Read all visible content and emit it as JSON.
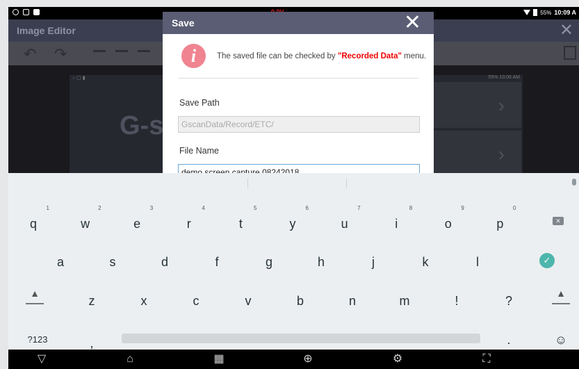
{
  "status_bar": {
    "battery_percent": "55%",
    "time": "10:09 A",
    "voltage": "0.0V"
  },
  "editor": {
    "title": "Image Editor",
    "preview_time": "55% 10:06 AM",
    "logo_text": "G-s"
  },
  "dialog": {
    "title": "Save",
    "message_prefix": "The saved file can be checked by ",
    "message_highlight": "\"Recorded Data\"",
    "message_suffix": " menu.",
    "save_path_label": "Save Path",
    "save_path_value": "GscanData/Record/ETC/",
    "file_name_label": "File Name",
    "file_name_value": "demo screen capture 08242018"
  },
  "keyboard": {
    "row1": [
      {
        "key": "q",
        "hint": "1"
      },
      {
        "key": "w",
        "hint": "2"
      },
      {
        "key": "e",
        "hint": "3"
      },
      {
        "key": "r",
        "hint": "4"
      },
      {
        "key": "t",
        "hint": "5"
      },
      {
        "key": "y",
        "hint": "6"
      },
      {
        "key": "u",
        "hint": "7"
      },
      {
        "key": "i",
        "hint": "8"
      },
      {
        "key": "o",
        "hint": "9"
      },
      {
        "key": "p",
        "hint": "0"
      }
    ],
    "row2": [
      "a",
      "s",
      "d",
      "f",
      "g",
      "h",
      "j",
      "k",
      "l"
    ],
    "row3": [
      "z",
      "x",
      "c",
      "v",
      "b",
      "n",
      "m",
      "!",
      "?"
    ],
    "symbols_label": "?123",
    "comma": ",",
    "period": ".",
    "emoji": "☺"
  },
  "colors": {
    "dialog_header": "#5a5d74",
    "info_icon": "#f08490",
    "highlight": "#e00000",
    "enter_key": "#4db6ac"
  },
  "icons": [
    "back-icon",
    "home-icon",
    "recent-apps-icon",
    "browser-icon",
    "settings-icon",
    "screenshot-icon"
  ]
}
